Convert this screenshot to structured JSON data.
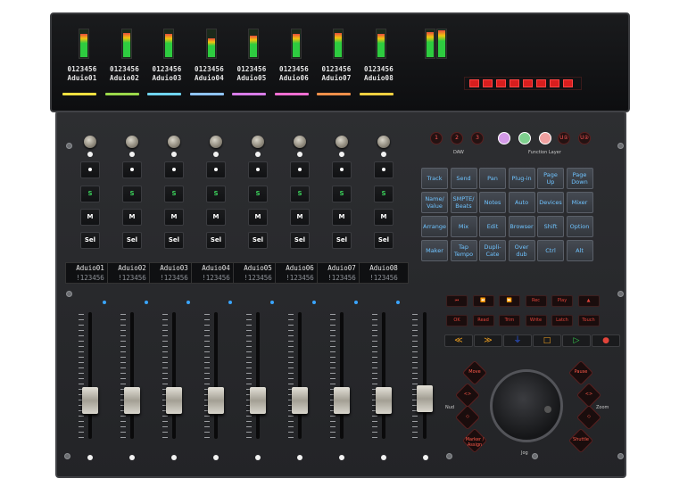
{
  "display": {
    "channels": [
      {
        "num": "0123456",
        "name": "Aduio01",
        "color": "#f0e040",
        "meter": 0.85
      },
      {
        "num": "0123456",
        "name": "Aduio02",
        "color": "#9bd84a",
        "meter": 0.9
      },
      {
        "num": "0123456",
        "name": "Aduio03",
        "color": "#6fd4f0",
        "meter": 0.88
      },
      {
        "num": "0123456",
        "name": "Aduio04",
        "color": "#8fc4ff",
        "meter": 0.7
      },
      {
        "num": "0123456",
        "name": "Aduio05",
        "color": "#d87ce8",
        "meter": 0.8
      },
      {
        "num": "0123456",
        "name": "Aduio06",
        "color": "#f06fd2",
        "meter": 0.85
      },
      {
        "num": "0123456",
        "name": "Aduio07",
        "color": "#f0904a",
        "meter": 0.9
      },
      {
        "num": "0123456",
        "name": "Aduio08",
        "color": "#f0d040",
        "meter": 0.88
      }
    ],
    "timecode": "88888888"
  },
  "channel_buttons": {
    "s": "S",
    "m": "M",
    "sel": "Sel"
  },
  "strips": [
    {
      "name": "Aduio01",
      "sub": "!123456"
    },
    {
      "name": "Aduio02",
      "sub": "!123456"
    },
    {
      "name": "Aduio03",
      "sub": "!123456"
    },
    {
      "name": "Aduio04",
      "sub": "!123456"
    },
    {
      "name": "Aduio05",
      "sub": "!123456"
    },
    {
      "name": "Aduio06",
      "sub": "!123456"
    },
    {
      "name": "Aduio07",
      "sub": "!123456"
    },
    {
      "name": "Aduio08",
      "sub": "!123456"
    }
  ],
  "bank": {
    "buttons": [
      "1",
      "2",
      "3"
    ],
    "label": "DAW"
  },
  "function_layer": {
    "label": "Function Layer",
    "u1": "U①",
    "u2": "U②"
  },
  "pads": [
    [
      "Track",
      "Send",
      "Pan",
      "Plug-in",
      "Page\nUp",
      "Page\nDown"
    ],
    [
      "Name/\nValue",
      "SMPTE/\nBeats",
      "Notes",
      "Auto",
      "Devices",
      "Mixer"
    ],
    [
      "Arrange",
      "Mix",
      "Edit",
      "Browser",
      "Shift",
      "Option"
    ],
    [
      "Maker",
      "Tap\nTempo",
      "Dupli-\nCate",
      "Over dub",
      "Ctrl",
      "Alt"
    ]
  ],
  "transport_row1": [
    "⏮",
    "⏪",
    "⏩",
    "Rec",
    "Play",
    "▲"
  ],
  "transport_row2": [
    "OK",
    "Read",
    "Trim",
    "Write",
    "Latch",
    "Touch"
  ],
  "transport_row3": [
    "≪",
    "≫",
    "⏚",
    "□",
    "▷",
    "●"
  ],
  "jog": {
    "left_label": "Nud",
    "right_label": "Zoom",
    "bottom_label": "Jog",
    "buttons": [
      "Move",
      "Pause",
      "<>",
      "<>",
      "◇",
      "◇",
      "Marker /\nAssign",
      "Shuttle"
    ]
  }
}
